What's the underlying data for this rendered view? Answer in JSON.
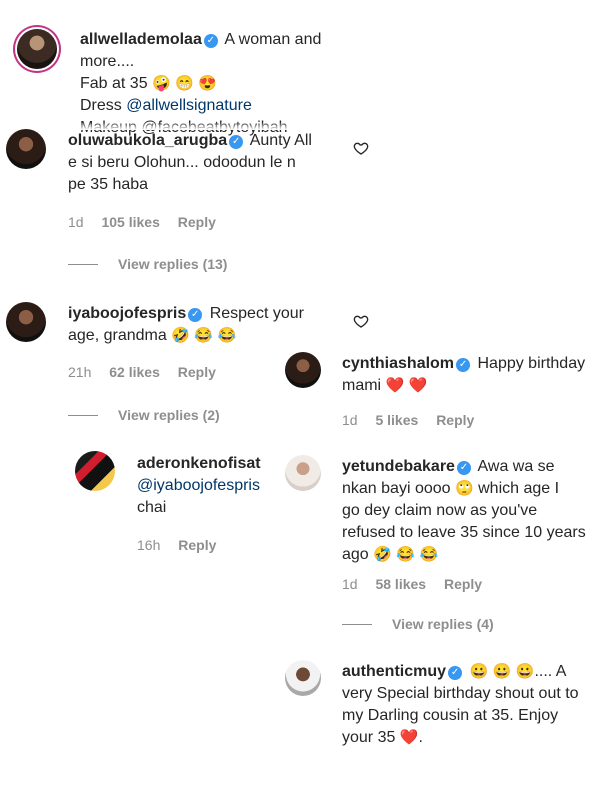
{
  "caption": {
    "username": "allwellademolaa",
    "lines": [
      "A woman and",
      "more....",
      "Fab at 35",
      "Dress",
      "@allwellsignature",
      "Makeup @facebeatbytoyibah"
    ],
    "emojis_fab": [
      "🤪",
      "😁",
      "😍"
    ]
  },
  "comments": [
    {
      "username": "oluwabukola_arugba",
      "text_line1": "Aunty All",
      "text_line2": "e si beru Olohun... odoodun le n",
      "text_line3": "pe 35 haba",
      "time": "1d",
      "likes": "105 likes",
      "reply": "Reply",
      "view_replies": "View replies (13)"
    },
    {
      "username": "iyaboojofespris",
      "text_line1": "Respect your",
      "text_line2": "age, grandma",
      "emojis": [
        "🤣",
        "😂",
        "😂"
      ],
      "time": "21h",
      "likes": "62 likes",
      "reply": "Reply",
      "view_replies": "View replies (2)"
    },
    {
      "username": "aderonkenofisat",
      "mention": "@iyaboojofespris",
      "text": "chai",
      "time": "16h",
      "reply": "Reply"
    },
    {
      "username": "cynthiashalom",
      "text_line1": "Happy birthday",
      "text_line2": "mami",
      "emojis": [
        "❤️",
        "❤️"
      ],
      "time": "1d",
      "likes": "5 likes",
      "reply": "Reply"
    },
    {
      "username": "yetundebakare",
      "text_line1": "Awa wa se",
      "text_line2": "nkan bayi oooo",
      "emoji_mid": "🙄",
      "text_line2b": "which age I",
      "text_line3": "go dey claim now as you've",
      "text_line4": "refused to leave 35 since 10 years",
      "text_line5": "ago",
      "emojis": [
        "🤣",
        "😂",
        "😂"
      ],
      "time": "1d",
      "likes": "58 likes",
      "reply": "Reply",
      "view_replies": "View replies (4)"
    },
    {
      "username": "authenticmuy",
      "emojis": [
        "😀",
        "😀",
        "😀"
      ],
      "text_line1": ".... A",
      "text_line2": "very Special birthday shout out to",
      "text_line3": "my Darling cousin at 35. Enjoy",
      "text_line4": "your 35",
      "emoji_end": "❤️",
      "text_end": "."
    }
  ],
  "colors": {
    "verified": "#3897f0",
    "mention": "#00376b",
    "meta": "#8e8e8e",
    "heart": "#e0245e"
  },
  "icons": [
    "verified-badge-icon",
    "heart-outline-icon",
    "heart-emoji-icon"
  ]
}
